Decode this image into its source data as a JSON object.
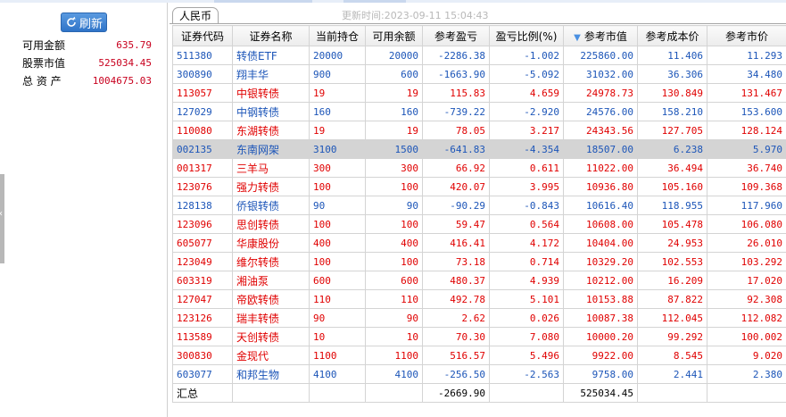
{
  "colors": {
    "profit": "#e00000",
    "loss": "#1c55b8",
    "accent": "#2f74c8",
    "selected_row": "#d4d4d4"
  },
  "left": {
    "refresh_label": "刷新",
    "summary": [
      {
        "label": "可用金额",
        "value": "635.79"
      },
      {
        "label": "股票市值",
        "value": "525034.45"
      },
      {
        "label": "总 资 产",
        "value": "1004675.03"
      }
    ]
  },
  "tab": {
    "label": "人民币"
  },
  "update_time": "更新时间:2023-09-11 15:04:43",
  "table": {
    "columns": [
      "证券代码",
      "证券名称",
      "当前持仓",
      "可用余额",
      "参考盈亏",
      "盈亏比例(%)",
      "参考市值",
      "参考成本价",
      "参考市价"
    ],
    "sort_icon": "sort-desc-icon",
    "rows": [
      {
        "code": "511380",
        "name": "转债ETF",
        "hold": "20000",
        "avail": "20000",
        "pnl": "-2286.38",
        "pct": "-1.002",
        "mv": "225860.00",
        "cost": "11.406",
        "price": "11.293",
        "tone": "blue"
      },
      {
        "code": "300890",
        "name": "翔丰华",
        "hold": "900",
        "avail": "600",
        "pnl": "-1663.90",
        "pct": "-5.092",
        "mv": "31032.00",
        "cost": "36.306",
        "price": "34.480",
        "tone": "blue"
      },
      {
        "code": "113057",
        "name": "中银转债",
        "hold": "19",
        "avail": "19",
        "pnl": "115.83",
        "pct": "4.659",
        "mv": "24978.73",
        "cost": "130.849",
        "price": "131.467",
        "tone": "red"
      },
      {
        "code": "127029",
        "name": "中钢转债",
        "hold": "160",
        "avail": "160",
        "pnl": "-739.22",
        "pct": "-2.920",
        "mv": "24576.00",
        "cost": "158.210",
        "price": "153.600",
        "tone": "blue"
      },
      {
        "code": "110080",
        "name": "东湖转债",
        "hold": "19",
        "avail": "19",
        "pnl": "78.05",
        "pct": "3.217",
        "mv": "24343.56",
        "cost": "127.705",
        "price": "128.124",
        "tone": "red"
      },
      {
        "code": "002135",
        "name": "东南网架",
        "hold": "3100",
        "avail": "1500",
        "pnl": "-641.83",
        "pct": "-4.354",
        "mv": "18507.00",
        "cost": "6.238",
        "price": "5.970",
        "tone": "blue",
        "selected": true
      },
      {
        "code": "001317",
        "name": "三羊马",
        "hold": "300",
        "avail": "300",
        "pnl": "66.92",
        "pct": "0.611",
        "mv": "11022.00",
        "cost": "36.494",
        "price": "36.740",
        "tone": "red"
      },
      {
        "code": "123076",
        "name": "强力转债",
        "hold": "100",
        "avail": "100",
        "pnl": "420.07",
        "pct": "3.995",
        "mv": "10936.80",
        "cost": "105.160",
        "price": "109.368",
        "tone": "red"
      },
      {
        "code": "128138",
        "name": "侨银转债",
        "hold": "90",
        "avail": "90",
        "pnl": "-90.29",
        "pct": "-0.843",
        "mv": "10616.40",
        "cost": "118.955",
        "price": "117.960",
        "tone": "blue"
      },
      {
        "code": "123096",
        "name": "思创转债",
        "hold": "100",
        "avail": "100",
        "pnl": "59.47",
        "pct": "0.564",
        "mv": "10608.00",
        "cost": "105.478",
        "price": "106.080",
        "tone": "red"
      },
      {
        "code": "605077",
        "name": "华康股份",
        "hold": "400",
        "avail": "400",
        "pnl": "416.41",
        "pct": "4.172",
        "mv": "10404.00",
        "cost": "24.953",
        "price": "26.010",
        "tone": "red"
      },
      {
        "code": "123049",
        "name": "维尔转债",
        "hold": "100",
        "avail": "100",
        "pnl": "73.18",
        "pct": "0.714",
        "mv": "10329.20",
        "cost": "102.553",
        "price": "103.292",
        "tone": "red"
      },
      {
        "code": "603319",
        "name": "湘油泵",
        "hold": "600",
        "avail": "600",
        "pnl": "480.37",
        "pct": "4.939",
        "mv": "10212.00",
        "cost": "16.209",
        "price": "17.020",
        "tone": "red"
      },
      {
        "code": "127047",
        "name": "帝欧转债",
        "hold": "110",
        "avail": "110",
        "pnl": "492.78",
        "pct": "5.101",
        "mv": "10153.88",
        "cost": "87.822",
        "price": "92.308",
        "tone": "red"
      },
      {
        "code": "123126",
        "name": "瑞丰转债",
        "hold": "90",
        "avail": "90",
        "pnl": "2.62",
        "pct": "0.026",
        "mv": "10087.38",
        "cost": "112.045",
        "price": "112.082",
        "tone": "red"
      },
      {
        "code": "113589",
        "name": "天创转债",
        "hold": "10",
        "avail": "10",
        "pnl": "70.30",
        "pct": "7.080",
        "mv": "10000.20",
        "cost": "99.292",
        "price": "100.002",
        "tone": "red"
      },
      {
        "code": "300830",
        "name": "金现代",
        "hold": "1100",
        "avail": "1100",
        "pnl": "516.57",
        "pct": "5.496",
        "mv": "9922.00",
        "cost": "8.545",
        "price": "9.020",
        "tone": "red"
      },
      {
        "code": "603077",
        "name": "和邦生物",
        "hold": "4100",
        "avail": "4100",
        "pnl": "-256.50",
        "pct": "-2.563",
        "mv": "9758.00",
        "cost": "2.441",
        "price": "2.380",
        "tone": "blue"
      }
    ],
    "total": {
      "label": "汇总",
      "pnl": "-2669.90",
      "mv": "525034.45"
    }
  }
}
